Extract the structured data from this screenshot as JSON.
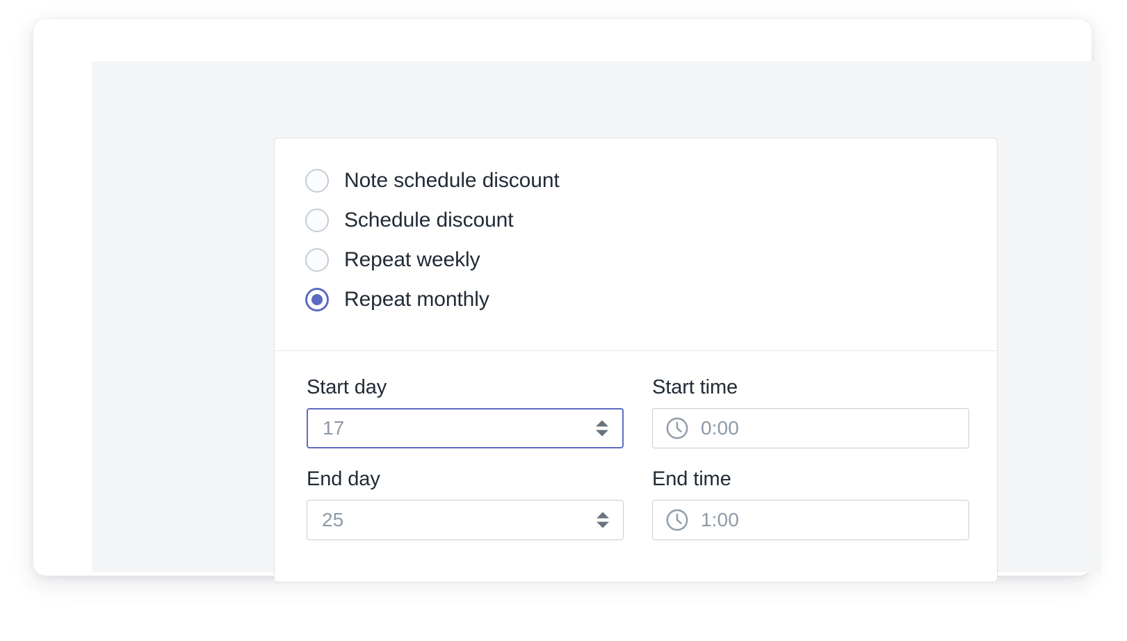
{
  "schedule_options": {
    "items": [
      {
        "label": "Note schedule discount",
        "selected": false
      },
      {
        "label": "Schedule discount",
        "selected": false
      },
      {
        "label": "Repeat weekly",
        "selected": false
      },
      {
        "label": "Repeat monthly",
        "selected": true
      }
    ]
  },
  "fields": {
    "start_day": {
      "label": "Start day",
      "value": "17",
      "control": "number-stepper",
      "focused": true
    },
    "start_time": {
      "label": "Start time",
      "value": "0:00",
      "control": "time-picker",
      "icon": "clock-icon",
      "focused": false
    },
    "end_day": {
      "label": "End day",
      "value": "25",
      "control": "number-stepper",
      "focused": false
    },
    "end_time": {
      "label": "End time",
      "value": "1:00",
      "control": "time-picker",
      "icon": "clock-icon",
      "focused": false
    }
  },
  "colors": {
    "accent": "#5c6ac4",
    "text": "#212b36",
    "muted_text": "#8d9aa6",
    "border": "#c4cdd5",
    "panel_bg": "#f4f5f7",
    "card_bg": "#ffffff"
  }
}
